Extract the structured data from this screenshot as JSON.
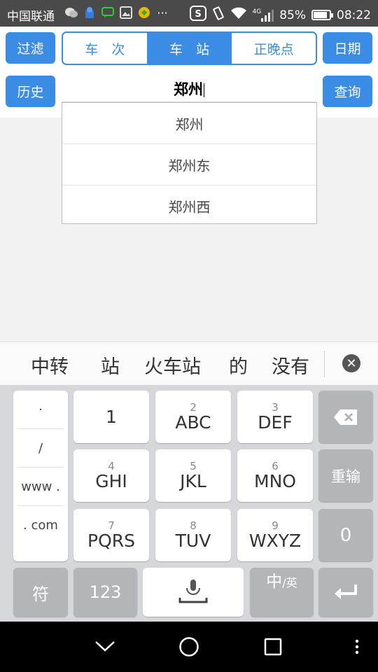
{
  "status_bar": {
    "carrier": "中国联通",
    "battery": "85%",
    "battery_level": 0.85,
    "network": "4G",
    "time": "08:22"
  },
  "header": {
    "filter_button": "过滤",
    "history_button": "历史",
    "date_button": "日期",
    "query_button": "查询",
    "tabs": [
      {
        "label": "车　次",
        "active": false
      },
      {
        "label": "车　站",
        "active": true
      },
      {
        "label": "正晚点",
        "active": false
      }
    ],
    "station_input_value": "郑州"
  },
  "dropdown": {
    "options": [
      "郑州",
      "郑州东",
      "郑州西"
    ]
  },
  "candidates": {
    "words": [
      "中转",
      "站",
      "火车站",
      "的",
      "没有"
    ]
  },
  "keyboard": {
    "symbols": [
      "·",
      "/",
      "www .",
      ". com"
    ],
    "keys": [
      {
        "num": "",
        "letters": "1"
      },
      {
        "num": "2",
        "letters": "ABC"
      },
      {
        "num": "3",
        "letters": "DEF"
      },
      {
        "num": "4",
        "letters": "GHI"
      },
      {
        "num": "5",
        "letters": "JKL"
      },
      {
        "num": "6",
        "letters": "MNO"
      },
      {
        "num": "7",
        "letters": "PQRS"
      },
      {
        "num": "8",
        "letters": "TUV"
      },
      {
        "num": "9",
        "letters": "WXYZ"
      }
    ],
    "reenter_label": "重输",
    "zero_label": "0",
    "symbol_label": "符",
    "num_label": "123",
    "lang_main": "中",
    "lang_sub": "/英"
  }
}
